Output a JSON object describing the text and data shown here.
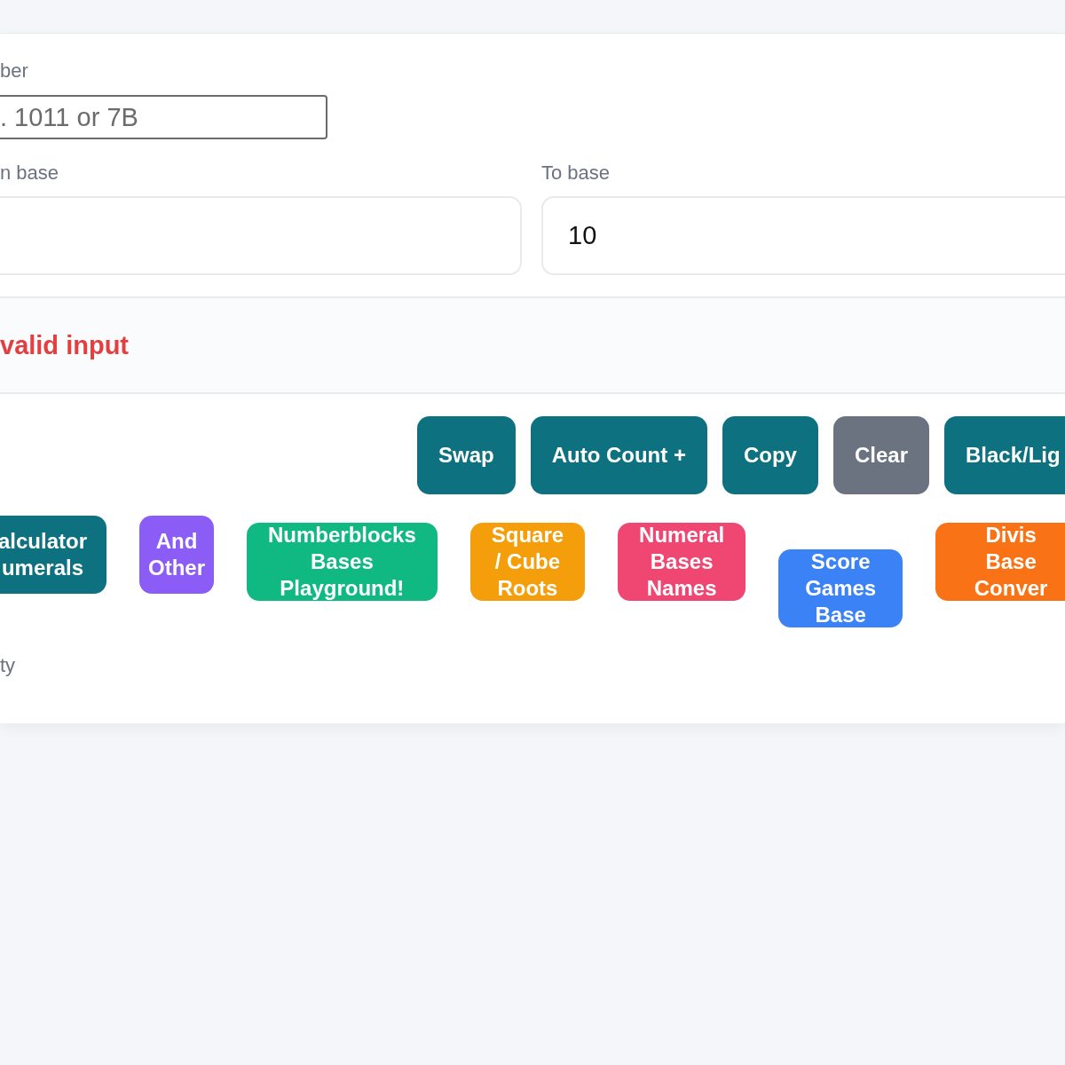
{
  "number_field": {
    "label": "ber",
    "placeholder": ". 1011 or 7B"
  },
  "from_base": {
    "label": "n base"
  },
  "to_base": {
    "label": "To base",
    "value": "10"
  },
  "result": {
    "message": "valid input"
  },
  "buttons": [
    {
      "label": "Swap",
      "kind": "primary"
    },
    {
      "label": "Auto Count +",
      "kind": "primary"
    },
    {
      "label": "Copy",
      "kind": "primary"
    },
    {
      "label": "Clear",
      "kind": "neutral"
    },
    {
      "label": "Black/Lig",
      "kind": "primary"
    }
  ],
  "links": [
    {
      "lines": [
        "alculator",
        "umerals"
      ],
      "color": "#0e7180"
    },
    {
      "lines": [
        "And",
        "Other"
      ],
      "color": "#8b5cf6"
    },
    {
      "lines": [
        "Numberblocks",
        "Bases",
        "Playground!"
      ],
      "color": "#10b981"
    },
    {
      "lines": [
        "Square",
        "/ Cube",
        "Roots"
      ],
      "color": "#f59e0b"
    },
    {
      "lines": [
        "Numeral",
        "Bases",
        "Names"
      ],
      "color": "#ef4672"
    },
    {
      "lines": [
        "Score",
        "Games",
        "Base"
      ],
      "color": "#3b82f6"
    },
    {
      "lines": [
        "Divis",
        "Base",
        "Conver"
      ],
      "color": "#f97316"
    }
  ],
  "footer_text": "ty"
}
